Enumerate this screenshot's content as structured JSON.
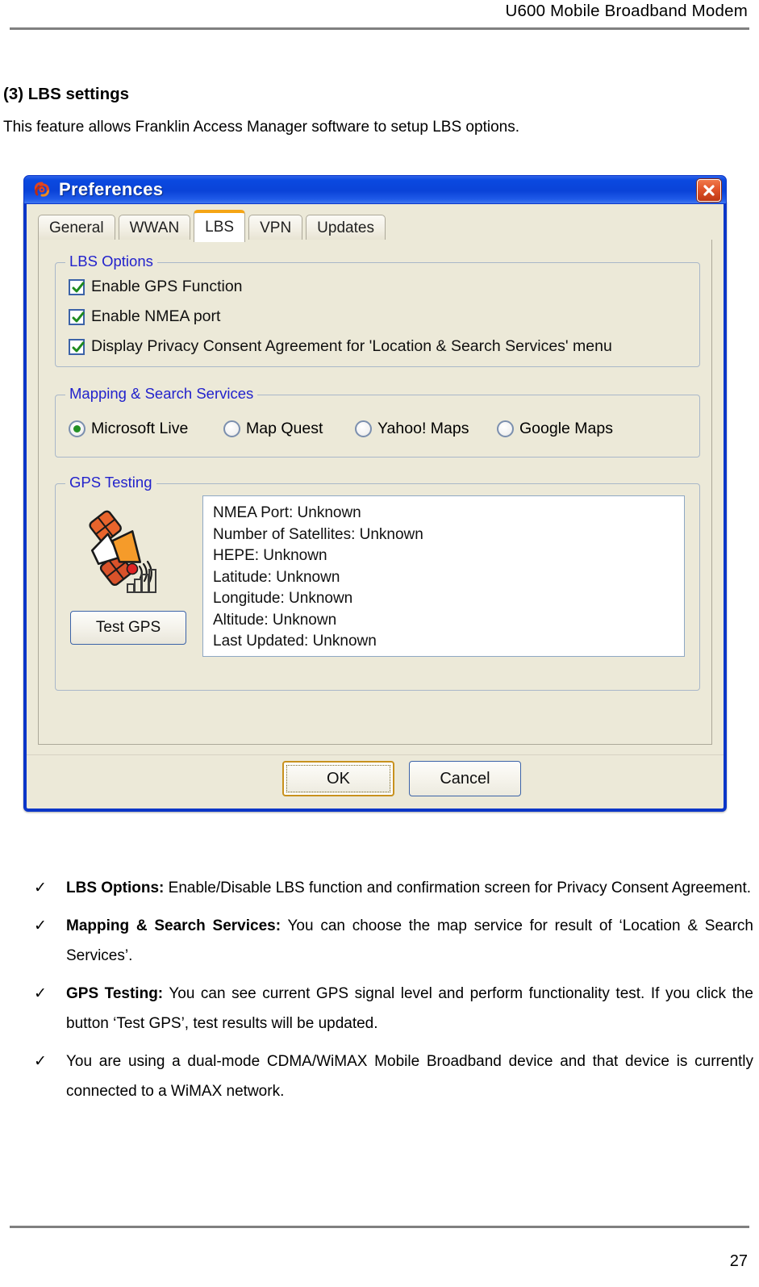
{
  "page": {
    "header_title": "U600 Mobile Broadband Modem",
    "section_heading": "(3) LBS settings",
    "section_intro": "This feature allows Franklin Access Manager software to setup LBS options.",
    "page_number": "27"
  },
  "dialog": {
    "title": "Preferences",
    "title_icon": "franklin-logo-icon",
    "close_icon": "close-icon",
    "tabs": [
      {
        "label": "General",
        "active": false
      },
      {
        "label": "WWAN",
        "active": false
      },
      {
        "label": "LBS",
        "active": true
      },
      {
        "label": "VPN",
        "active": false
      },
      {
        "label": "Updates",
        "active": false
      }
    ],
    "active_tab_accent": "#f5a515",
    "titlebar_color": "#0a43d8",
    "legend_color": "#2222cc",
    "lbs_options": {
      "legend": "LBS Options",
      "items": [
        {
          "label": "Enable GPS Function",
          "checked": true
        },
        {
          "label": "Enable NMEA port",
          "checked": true
        },
        {
          "label": "Display Privacy Consent Agreement for 'Location & Search Services' menu",
          "checked": true
        }
      ]
    },
    "mapping_services": {
      "legend": "Mapping & Search Services",
      "options": [
        {
          "label": "Microsoft Live",
          "selected": true
        },
        {
          "label": "Map Quest",
          "selected": false
        },
        {
          "label": "Yahoo! Maps",
          "selected": false
        },
        {
          "label": "Google Maps",
          "selected": false
        }
      ]
    },
    "gps_testing": {
      "legend": "GPS Testing",
      "icon": "gps-satellite-icon",
      "test_button": "Test GPS",
      "results": [
        "NMEA Port: Unknown",
        "Number of Satellites: Unknown",
        "HEPE: Unknown",
        "Latitude: Unknown",
        "Longitude: Unknown",
        "Altitude: Unknown",
        "Last Updated: Unknown"
      ]
    },
    "buttons": {
      "ok": "OK",
      "cancel": "Cancel"
    }
  },
  "bullets": [
    {
      "marker": "✓",
      "bold": "LBS Options:",
      "text": " Enable/Disable LBS function and confirmation screen for Privacy Consent Agreement."
    },
    {
      "marker": "✓",
      "bold": "Mapping & Search Services:",
      "text": " You can choose the map service for result of ‘Location & Search Services’."
    },
    {
      "marker": "✓",
      "bold": "GPS Testing:",
      "text": " You can see current GPS signal level and perform functionality test. If you click the button ‘Test GPS’, test results will be updated."
    },
    {
      "marker": "✓",
      "bold": "",
      "text": "You are using a dual-mode CDMA/WiMAX Mobile Broadband device and that device is currently connected to a WiMAX network."
    }
  ]
}
